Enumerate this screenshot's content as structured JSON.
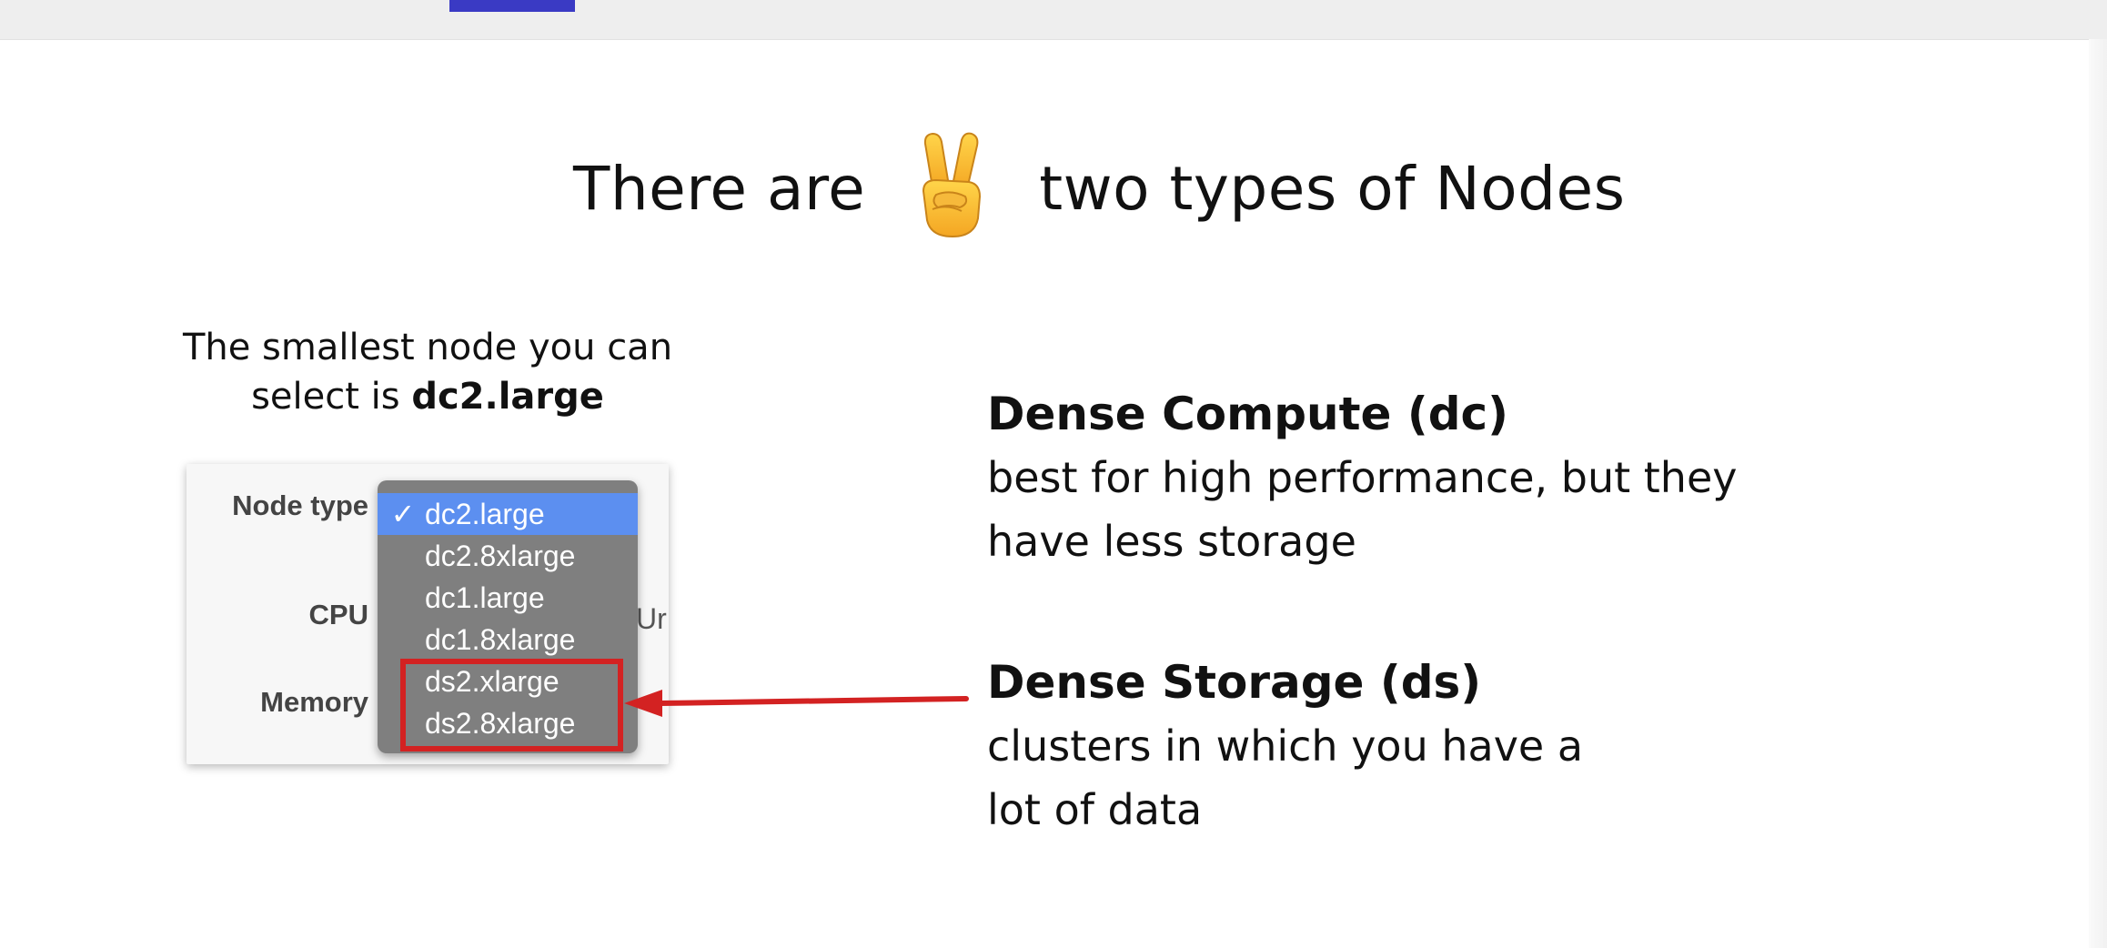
{
  "slide": {
    "title_before": "There are",
    "title_after": "two types of Nodes",
    "title_emoji": "victory-hand-emoji",
    "caption_prefix": "The smallest node you can select is ",
    "caption_bold": "dc2.large"
  },
  "node_panel": {
    "labels": {
      "node_type": "Node type",
      "cpu": "CPU",
      "memory": "Memory"
    },
    "partial_value": "Ur",
    "check_mark": "✓",
    "options": [
      "dc2.large",
      "dc2.8xlarge",
      "dc1.large",
      "dc1.8xlarge",
      "ds2.xlarge",
      "ds2.8xlarge"
    ],
    "selected": "dc2.large"
  },
  "types": {
    "dense_compute": {
      "heading": "Dense Compute (dc)",
      "description": "best for high performance, but they\nhave less storage"
    },
    "dense_storage": {
      "heading": "Dense Storage (ds)",
      "description": "clusters in which you have a\nlot of data"
    }
  },
  "colors": {
    "accent_bar": "#3a3ac4",
    "selected_option": "#5c8ff0",
    "dropdown_bg": "#7f7f7f",
    "highlight_red": "#d32222"
  }
}
